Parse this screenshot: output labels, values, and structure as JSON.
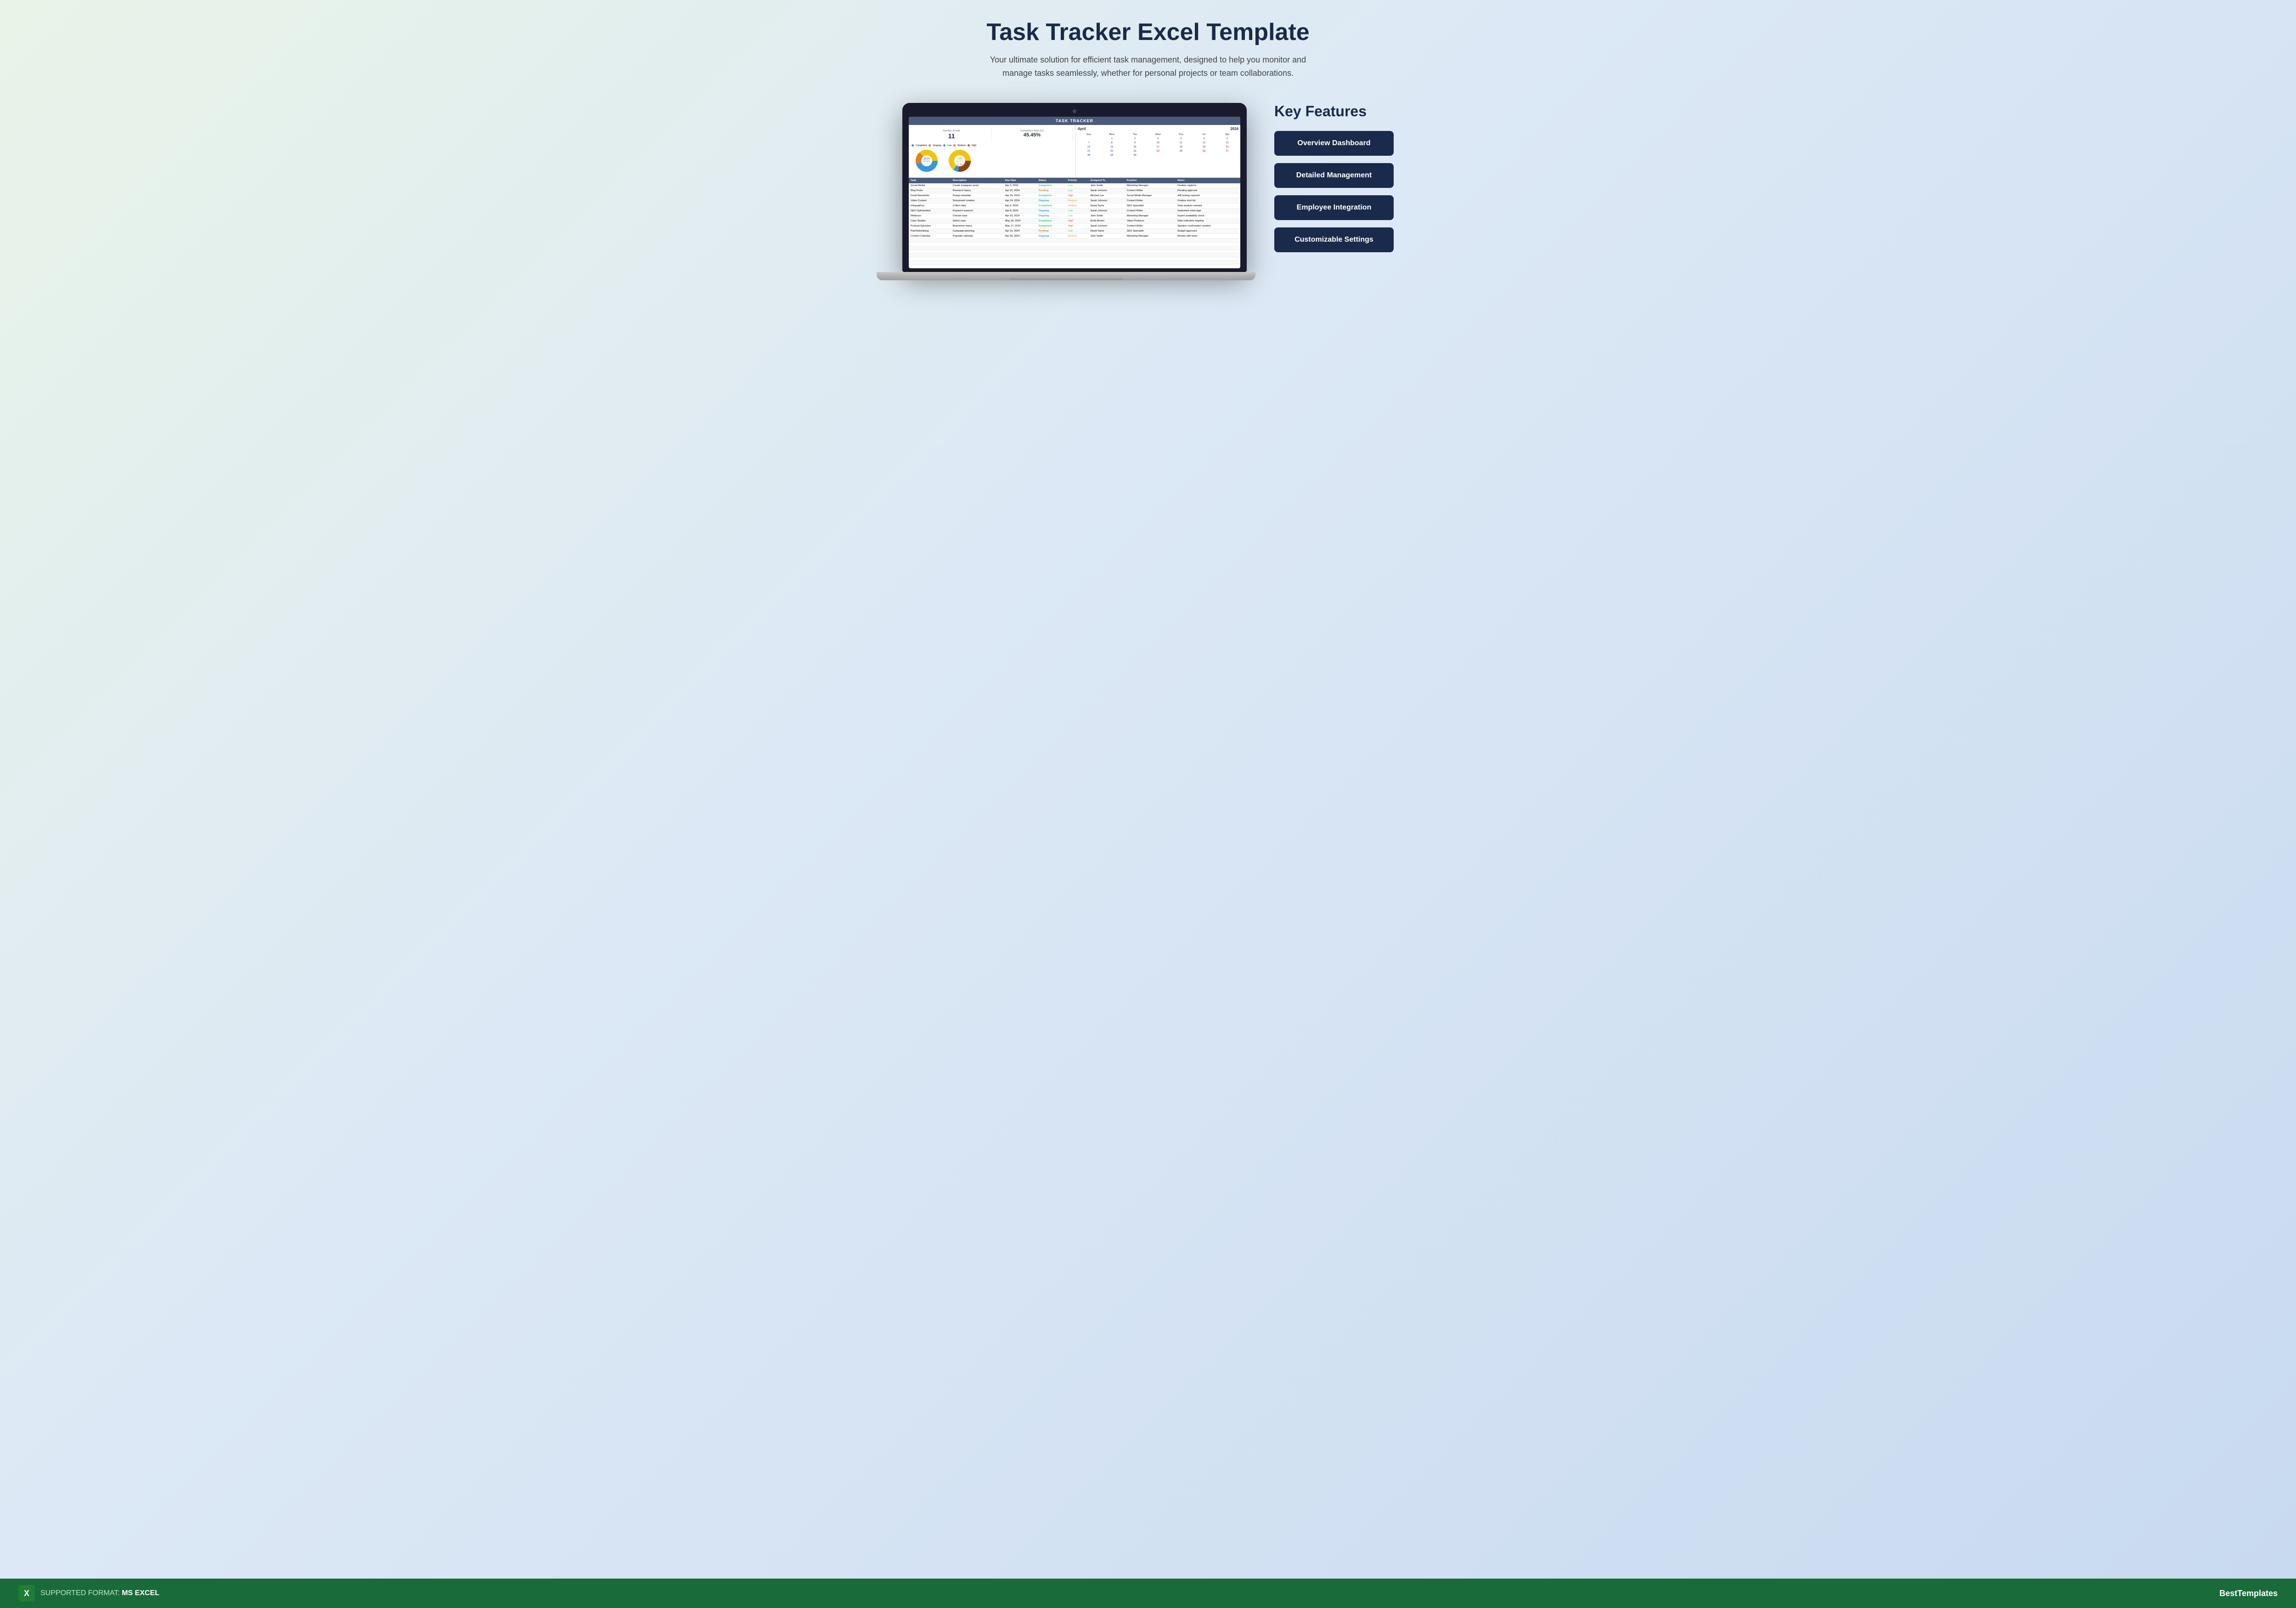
{
  "page": {
    "title": "Task Tracker Excel Template",
    "subtitle": "Your ultimate solution for efficient task management, designed to help you monitor and manage tasks seamlessly, whether for personal projects or team collaborations."
  },
  "spreadsheet": {
    "header": "TASK TRACKER",
    "metrics": {
      "number_of_tasks_label": "Number of task",
      "number_of_tasks_value": "11",
      "completion_rate_label": "Completion Rate (%)",
      "completion_rate_value": "45.45%"
    },
    "chart1": {
      "legend": [
        {
          "label": "Completed",
          "color": "#3498db"
        },
        {
          "label": "Ongoing",
          "color": "#e67e22"
        }
      ],
      "segments": [
        {
          "label": "18.2%",
          "value": 18.2,
          "color": "#e67e22"
        },
        {
          "label": "45.5%",
          "value": 45.5,
          "color": "#3498db"
        },
        {
          "label": "36.4%",
          "value": 36.4,
          "color": "#f1c40f"
        }
      ]
    },
    "chart2": {
      "legend": [
        {
          "label": "Low",
          "color": "#3498db"
        },
        {
          "label": "Medium",
          "color": "#e67e22"
        },
        {
          "label": "High",
          "color": "#e74c3c"
        }
      ],
      "segments": [
        {
          "label": "7.3%",
          "value": 7.3,
          "color": "#3498db"
        },
        {
          "label": "45.5%",
          "value": 45.5,
          "color": "#f1c40f"
        },
        {
          "label": "27.3%",
          "value": 27.3,
          "color": "#8b4513"
        }
      ]
    },
    "calendar": {
      "month": "April",
      "year": "2024",
      "days_header": [
        "Sun",
        "Mon",
        "Tue",
        "Wed",
        "Thu",
        "Fri",
        "Sat"
      ],
      "weeks": [
        [
          "",
          "1",
          "2",
          "3",
          "4",
          "5",
          "6"
        ],
        [
          "7",
          "8",
          "9",
          "10",
          "11",
          "12",
          "13"
        ],
        [
          "14",
          "15",
          "16",
          "17",
          "18",
          "19",
          "20"
        ],
        [
          "21",
          "22",
          "23",
          "24",
          "25",
          "26",
          "27"
        ],
        [
          "28",
          "29",
          "30",
          "",
          "",
          "",
          ""
        ]
      ],
      "red_days": [
        "3",
        "5",
        "20",
        "26"
      ],
      "blue_days": [
        "8",
        "29"
      ]
    },
    "table": {
      "headers": [
        "Task",
        "Description",
        "Due Date",
        "Status",
        "Priority",
        "Assigned To",
        "Position",
        "Notes"
      ],
      "rows": [
        {
          "task": "Social Media",
          "description": "Create instagram posts",
          "due_date": "Apr 3, 2024",
          "status": "Completed",
          "priority": "Low",
          "assigned_to": "John Smith",
          "position": "Marketing Manager",
          "notes": "Finalize captions"
        },
        {
          "task": "Blog Posts",
          "description": "Research topics",
          "due_date": "Apr 20, 2024",
          "status": "Pending",
          "priority": "Low",
          "assigned_to": "Sarah Johnson",
          "position": "Content Writer",
          "notes": "Pending approval"
        },
        {
          "task": "Email Newsletter",
          "description": "Design template",
          "due_date": "Apr 29, 2024",
          "status": "Completed",
          "priority": "High",
          "assigned_to": "Michael Lee",
          "position": "Social Media Manager",
          "notes": "A/B testing required"
        },
        {
          "task": "Video Content",
          "description": "Storyboard creation",
          "due_date": "Apr 24, 2024",
          "status": "Ongoing",
          "priority": "Medium",
          "assigned_to": "Sarah Johnson",
          "position": "Content Writer",
          "notes": "Finalize shot list"
        },
        {
          "task": "Infographics",
          "description": "Collect data",
          "due_date": "Apr 5, 2024",
          "status": "Completed",
          "priority": "Medium",
          "assigned_to": "David Taylor",
          "position": "SEO Specialist",
          "notes": "Data analysis needed"
        },
        {
          "task": "SEO Optimization",
          "description": "Keyword research",
          "due_date": "Apr 8, 2024",
          "status": "Ongoing",
          "priority": "Low",
          "assigned_to": "Sarah Johnson",
          "position": "Content Writer",
          "notes": "Implement meta tags"
        },
        {
          "task": "Webinars",
          "description": "Choose topic",
          "due_date": "Apr 29, 2024",
          "status": "Ongoing",
          "priority": "Low",
          "assigned_to": "John Smith",
          "position": "Marketing Manager",
          "notes": "Expert availability check"
        },
        {
          "task": "Case Studies",
          "description": "Select case",
          "due_date": "May 18, 2024",
          "status": "Completed",
          "priority": "High",
          "assigned_to": "Emily Brown",
          "position": "Video Producer",
          "notes": "Data collection ongoing"
        },
        {
          "task": "Podcast Episodes",
          "description": "Brainstorm topics",
          "due_date": "May 17, 2024",
          "status": "Completed",
          "priority": "High",
          "assigned_to": "Sarah Johnson",
          "position": "Content Writer",
          "notes": "Speaker confirmation needed"
        },
        {
          "task": "Paid Advertising",
          "description": "Campaign planning",
          "due_date": "Apr 10, 2024",
          "status": "Pending",
          "priority": "Low",
          "assigned_to": "David Taylor",
          "position": "SEO Specialist",
          "notes": "Budget approved"
        },
        {
          "task": "Content Calendar",
          "description": "Populate calendar",
          "due_date": "Apr 26, 2024",
          "status": "Ongoing",
          "priority": "Medium",
          "assigned_to": "John Smith",
          "position": "Marketing Manager",
          "notes": "Review with team"
        }
      ]
    }
  },
  "features": {
    "title": "Key Features",
    "buttons": [
      {
        "label": "Overview Dashboard",
        "id": "overview-dashboard"
      },
      {
        "label": "Detailed Management",
        "id": "detailed-management"
      },
      {
        "label": "Employee Integration",
        "id": "employee-integration"
      },
      {
        "label": "Customizable Settings",
        "id": "customizable-settings"
      }
    ]
  },
  "footer": {
    "format_label": "SUPPORTED FORMAT: ",
    "format_value": "MS EXCEL",
    "brand": "BestTemplates"
  }
}
